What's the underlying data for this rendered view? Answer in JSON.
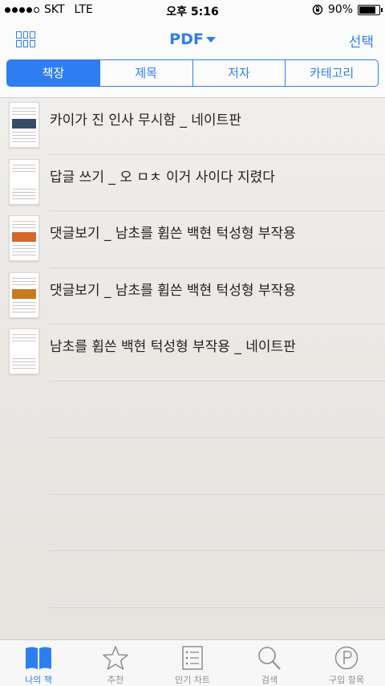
{
  "status": {
    "carrier": "SKT",
    "network": "LTE",
    "time": "오후 5:16",
    "battery": "90%",
    "battery_level": 0.9
  },
  "nav": {
    "title": "PDF",
    "select_label": "선택"
  },
  "segments": [
    {
      "label": "책장",
      "active": true
    },
    {
      "label": "제목",
      "active": false
    },
    {
      "label": "저자",
      "active": false
    },
    {
      "label": "카테고리",
      "active": false
    }
  ],
  "books": [
    {
      "title": "카이가 진 인사 무시함 _ 네이트판",
      "thumb_color": "#3a4a6a"
    },
    {
      "title": "답글 쓰기 _ 오 ㅁㅊ 이거 사이다 지렸다",
      "thumb_color": ""
    },
    {
      "title": "댓글보기 _ 남초를 휩쓴 백현 턱성형 부작용",
      "thumb_color": "#d4692a"
    },
    {
      "title": "댓글보기 _ 남초를 휩쓴 백현 턱성형 부작용",
      "thumb_color": "#c87a20"
    },
    {
      "title": "남초를 휩쓴 백현 턱성형 부작용 _ 네이트판",
      "thumb_color": ""
    }
  ],
  "tabs": [
    {
      "label": "나의 책",
      "icon": "book-icon",
      "active": true
    },
    {
      "label": "추천",
      "icon": "star-icon",
      "active": false
    },
    {
      "label": "인기 차트",
      "icon": "chart-list-icon",
      "active": false
    },
    {
      "label": "검색",
      "icon": "search-icon",
      "active": false
    },
    {
      "label": "구입 항목",
      "icon": "purchased-icon",
      "active": false
    }
  ],
  "colors": {
    "accent": "#2f7ef1"
  }
}
